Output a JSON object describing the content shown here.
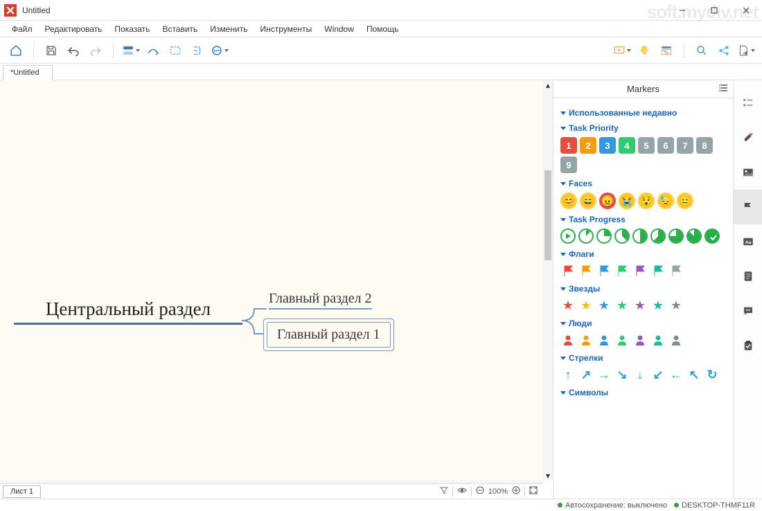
{
  "window": {
    "title": "Untitled"
  },
  "menu": [
    "Файл",
    "Редактировать",
    "Показать",
    "Вставить",
    "Изменить",
    "Инструменты",
    "Window",
    "Помощь"
  ],
  "doc_tab": "*Untitled",
  "sheet_tab": "Лист 1",
  "zoom": "100%",
  "mindmap": {
    "central": "Центральный раздел",
    "sub1": "Главный раздел 1",
    "sub2": "Главный раздел 2"
  },
  "side": {
    "title": "Markers",
    "sections": {
      "recent": "Использованные недавно",
      "priority": "Task Priority",
      "faces": "Faces",
      "progress": "Task Progress",
      "flags": "Флаги",
      "stars": "Звезды",
      "people": "Люди",
      "arrows": "Стрелки",
      "symbols": "Символы"
    },
    "priority_colors": [
      "#e74c3c",
      "#f39c12",
      "#3498db",
      "#2ecc71",
      "#95a5a6",
      "#95a5a6",
      "#95a5a6",
      "#95a5a6",
      "#95a5a6"
    ],
    "flag_colors": [
      "#e74c3c",
      "#f39c12",
      "#3498db",
      "#2ecc71",
      "#9b59b6",
      "#1abc9c",
      "#95a5a6"
    ],
    "star_colors": [
      "#e74c3c",
      "#f1c40f",
      "#3498db",
      "#2ecc71",
      "#9b59b6",
      "#1abc9c",
      "#7f8c8d"
    ],
    "people_colors": [
      "#e74c3c",
      "#f39c12",
      "#3498db",
      "#2ecc71",
      "#9b59b6",
      "#1abc9c",
      "#7f8c8d"
    ],
    "arrow_color": "#2aa0d8"
  },
  "status": {
    "autosave_label": "Автосохранение: выключено",
    "computer": "DESKTOP-THMF11R"
  },
  "watermark": "soft.mydiv.net"
}
